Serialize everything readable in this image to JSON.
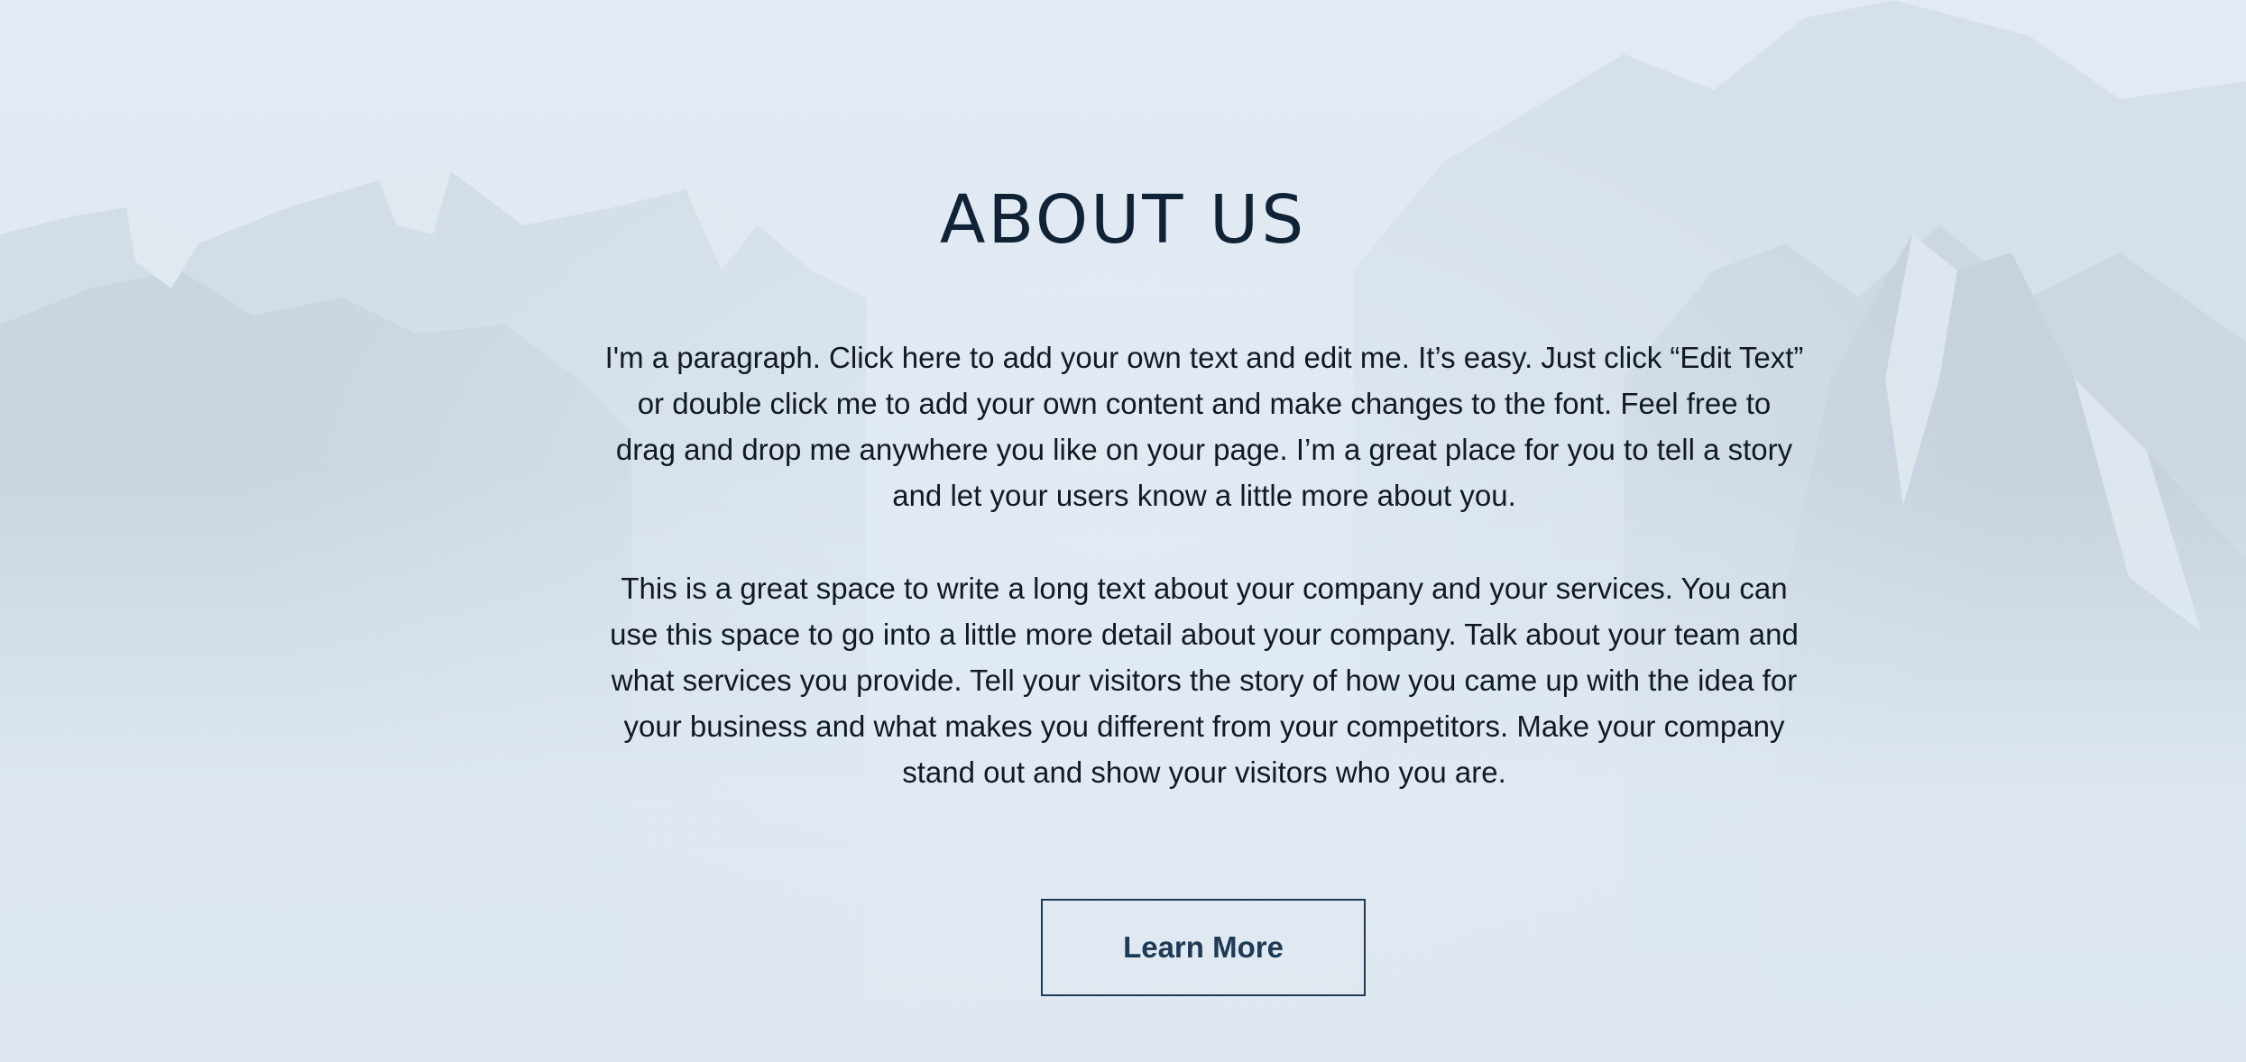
{
  "section": {
    "title": "ABOUT US",
    "paragraphs": [
      "I'm a paragraph. Click here to add your own text and edit me. It’s easy. Just click “Edit Text” or double click me to add your own content and make changes to the font. Feel free to drag and drop me anywhere you like on your page. I’m a great place for you to tell a story and let your users know a little more about you.",
      "This is a great space to write a long text about your company and your services. You can use this space to go into a little more detail about your company. Talk about your team and what services you provide. Tell your visitors the story of how you came up with the idea for your business and what makes you different from your competitors. Make your company stand out and show your visitors who you are."
    ],
    "button_label": "Learn More"
  },
  "colors": {
    "background": "#dfe8f1",
    "title": "#0f2236",
    "text": "#111a24",
    "accent": "#1e3a56"
  }
}
